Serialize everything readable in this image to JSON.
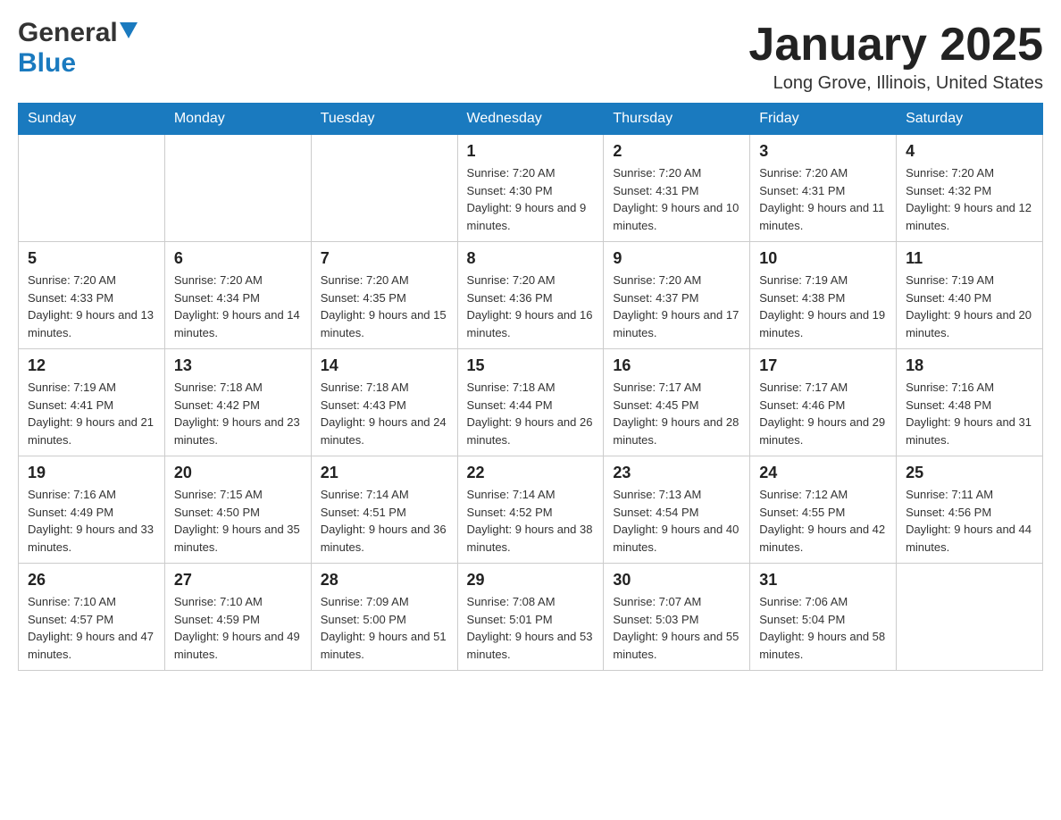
{
  "header": {
    "logo_general": "General",
    "logo_blue": "Blue",
    "title": "January 2025",
    "subtitle": "Long Grove, Illinois, United States"
  },
  "days_of_week": [
    "Sunday",
    "Monday",
    "Tuesday",
    "Wednesday",
    "Thursday",
    "Friday",
    "Saturday"
  ],
  "weeks": [
    [
      {
        "day": "",
        "info": ""
      },
      {
        "day": "",
        "info": ""
      },
      {
        "day": "",
        "info": ""
      },
      {
        "day": "1",
        "info": "Sunrise: 7:20 AM\nSunset: 4:30 PM\nDaylight: 9 hours\nand 9 minutes."
      },
      {
        "day": "2",
        "info": "Sunrise: 7:20 AM\nSunset: 4:31 PM\nDaylight: 9 hours\nand 10 minutes."
      },
      {
        "day": "3",
        "info": "Sunrise: 7:20 AM\nSunset: 4:31 PM\nDaylight: 9 hours\nand 11 minutes."
      },
      {
        "day": "4",
        "info": "Sunrise: 7:20 AM\nSunset: 4:32 PM\nDaylight: 9 hours\nand 12 minutes."
      }
    ],
    [
      {
        "day": "5",
        "info": "Sunrise: 7:20 AM\nSunset: 4:33 PM\nDaylight: 9 hours\nand 13 minutes."
      },
      {
        "day": "6",
        "info": "Sunrise: 7:20 AM\nSunset: 4:34 PM\nDaylight: 9 hours\nand 14 minutes."
      },
      {
        "day": "7",
        "info": "Sunrise: 7:20 AM\nSunset: 4:35 PM\nDaylight: 9 hours\nand 15 minutes."
      },
      {
        "day": "8",
        "info": "Sunrise: 7:20 AM\nSunset: 4:36 PM\nDaylight: 9 hours\nand 16 minutes."
      },
      {
        "day": "9",
        "info": "Sunrise: 7:20 AM\nSunset: 4:37 PM\nDaylight: 9 hours\nand 17 minutes."
      },
      {
        "day": "10",
        "info": "Sunrise: 7:19 AM\nSunset: 4:38 PM\nDaylight: 9 hours\nand 19 minutes."
      },
      {
        "day": "11",
        "info": "Sunrise: 7:19 AM\nSunset: 4:40 PM\nDaylight: 9 hours\nand 20 minutes."
      }
    ],
    [
      {
        "day": "12",
        "info": "Sunrise: 7:19 AM\nSunset: 4:41 PM\nDaylight: 9 hours\nand 21 minutes."
      },
      {
        "day": "13",
        "info": "Sunrise: 7:18 AM\nSunset: 4:42 PM\nDaylight: 9 hours\nand 23 minutes."
      },
      {
        "day": "14",
        "info": "Sunrise: 7:18 AM\nSunset: 4:43 PM\nDaylight: 9 hours\nand 24 minutes."
      },
      {
        "day": "15",
        "info": "Sunrise: 7:18 AM\nSunset: 4:44 PM\nDaylight: 9 hours\nand 26 minutes."
      },
      {
        "day": "16",
        "info": "Sunrise: 7:17 AM\nSunset: 4:45 PM\nDaylight: 9 hours\nand 28 minutes."
      },
      {
        "day": "17",
        "info": "Sunrise: 7:17 AM\nSunset: 4:46 PM\nDaylight: 9 hours\nand 29 minutes."
      },
      {
        "day": "18",
        "info": "Sunrise: 7:16 AM\nSunset: 4:48 PM\nDaylight: 9 hours\nand 31 minutes."
      }
    ],
    [
      {
        "day": "19",
        "info": "Sunrise: 7:16 AM\nSunset: 4:49 PM\nDaylight: 9 hours\nand 33 minutes."
      },
      {
        "day": "20",
        "info": "Sunrise: 7:15 AM\nSunset: 4:50 PM\nDaylight: 9 hours\nand 35 minutes."
      },
      {
        "day": "21",
        "info": "Sunrise: 7:14 AM\nSunset: 4:51 PM\nDaylight: 9 hours\nand 36 minutes."
      },
      {
        "day": "22",
        "info": "Sunrise: 7:14 AM\nSunset: 4:52 PM\nDaylight: 9 hours\nand 38 minutes."
      },
      {
        "day": "23",
        "info": "Sunrise: 7:13 AM\nSunset: 4:54 PM\nDaylight: 9 hours\nand 40 minutes."
      },
      {
        "day": "24",
        "info": "Sunrise: 7:12 AM\nSunset: 4:55 PM\nDaylight: 9 hours\nand 42 minutes."
      },
      {
        "day": "25",
        "info": "Sunrise: 7:11 AM\nSunset: 4:56 PM\nDaylight: 9 hours\nand 44 minutes."
      }
    ],
    [
      {
        "day": "26",
        "info": "Sunrise: 7:10 AM\nSunset: 4:57 PM\nDaylight: 9 hours\nand 47 minutes."
      },
      {
        "day": "27",
        "info": "Sunrise: 7:10 AM\nSunset: 4:59 PM\nDaylight: 9 hours\nand 49 minutes."
      },
      {
        "day": "28",
        "info": "Sunrise: 7:09 AM\nSunset: 5:00 PM\nDaylight: 9 hours\nand 51 minutes."
      },
      {
        "day": "29",
        "info": "Sunrise: 7:08 AM\nSunset: 5:01 PM\nDaylight: 9 hours\nand 53 minutes."
      },
      {
        "day": "30",
        "info": "Sunrise: 7:07 AM\nSunset: 5:03 PM\nDaylight: 9 hours\nand 55 minutes."
      },
      {
        "day": "31",
        "info": "Sunrise: 7:06 AM\nSunset: 5:04 PM\nDaylight: 9 hours\nand 58 minutes."
      },
      {
        "day": "",
        "info": ""
      }
    ]
  ]
}
